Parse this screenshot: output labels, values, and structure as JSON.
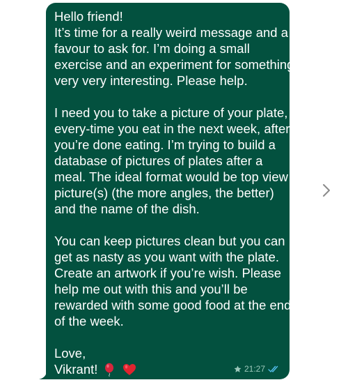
{
  "message": {
    "paragraphs": [
      {
        "lines": [
          "Hello friend!",
          "It’s time for a really weird message and a",
          "favour to ask for. I’m doing a small",
          "exercise and an experiment for something",
          "very very interesting. Please help."
        ]
      },
      {
        "lines": [
          "I need you to take a picture of your plate,",
          "every-time you eat in the next week, after",
          "you’re done eating. I’m trying to build a",
          "database of pictures of plates after a",
          "meal. The ideal format would be top view",
          "picture(s) (the more angles, the better)",
          "and the name of the dish."
        ]
      },
      {
        "lines": [
          "You can keep pictures clean but you can",
          "get as nasty as you want with the plate.",
          "Create an artwork if you’re wish. Please",
          "help me out with this and you’ll be",
          "rewarded with some good food at the end",
          "of the week."
        ]
      }
    ],
    "signoff": "Love,",
    "signature": "Vikrant!"
  },
  "meta": {
    "time": "21:27",
    "star_icon": "star-icon",
    "read_icon": "double-check-icon",
    "read_color": "#53bdeb"
  },
  "colors": {
    "bubble": "#03513f",
    "text": "#ffffff",
    "meta": "#9cc8bb"
  },
  "emojis": [
    "balloon-icon",
    "heart-icon"
  ]
}
